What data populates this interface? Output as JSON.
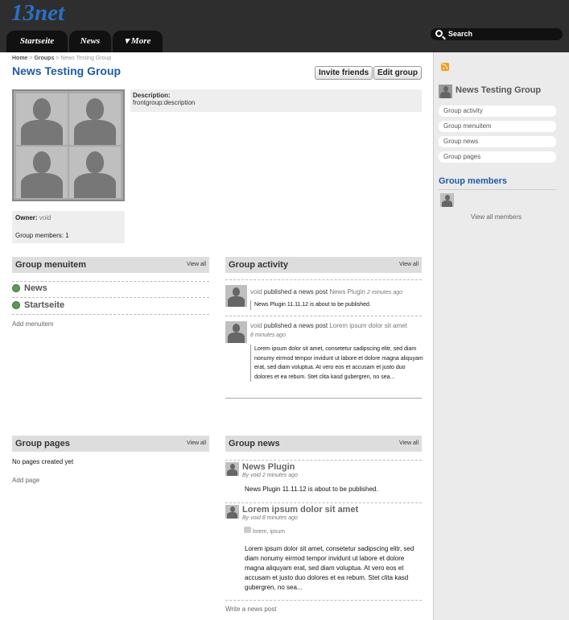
{
  "site": {
    "logo": "13net"
  },
  "nav": {
    "tabs": [
      "Startseite",
      "News",
      "▾ More"
    ],
    "search_label": "Search"
  },
  "breadcrumb": {
    "home": "Home",
    "sep1": ">",
    "groups": "Groups",
    "sep2": ">",
    "current": "News Testing Group"
  },
  "group": {
    "title": "News Testing Group",
    "invite_label": "Invite friends",
    "edit_label": "Edit group",
    "description_label": "Description:",
    "description_value": "frontgroup:description",
    "owner_label": "Owner:",
    "owner_value": "void",
    "members_text": "Group members: 1"
  },
  "menuitem_widget": {
    "title": "Group menuitem",
    "view_all": "View all",
    "items": [
      "News",
      "Startseite"
    ],
    "add_label": "Add menuitem"
  },
  "activity_widget": {
    "title": "Group activity",
    "view_all": "View all",
    "items": [
      {
        "user": "void",
        "action": "published a news post",
        "target": "News Plugin",
        "time": "2 minutes ago",
        "excerpt": "News Plugin 11.11.12 is about to be published."
      },
      {
        "user": "void",
        "action": "published a news post",
        "target": "Lorem ipsum dolor sit amet",
        "time": "8 minutes ago",
        "excerpt": "Lorem ipsum dolor sit amet, consetetur sadipscing elitr, sed diam nonumy eirmod tempor invidunt ut labore et dolore magna aliquyam erat, sed diam voluptua. At vero eos et accusam et justo duo dolores et ea rebum. Stet clita kasd gubergren, no sea..."
      }
    ]
  },
  "pages_widget": {
    "title": "Group pages",
    "view_all": "View all",
    "empty": "No pages created yet",
    "add_label": "Add page"
  },
  "news_widget": {
    "title": "Group news",
    "view_all": "View all",
    "posts": [
      {
        "title": "News Plugin",
        "byline": "By void 2 minutes ago",
        "body": "News Plugin 11.11.12 is about to be published."
      },
      {
        "title": "Lorem ipsum dolor sit amet",
        "byline": "By void 8 minutes ago",
        "tags": "lorem, ipsum",
        "body": "Lorem ipsum dolor sit amet, consetetur sadipscing elitr, sed diam nonumy eirmod tempor invidunt ut labore et dolore magna aliquyam erat, sed diam voluptua. At vero eos et accusam et justo duo dolores et ea rebum. Stet clita kasd gubergren, no sea..."
      }
    ],
    "write_label": "Write a news post"
  },
  "sidebar": {
    "group_name": "News Testing Group",
    "links": [
      "Group activity",
      "Group menuitem",
      "Group news",
      "Group pages"
    ],
    "members_title": "Group members",
    "view_all_members": "View all members"
  },
  "icons": {
    "rss": "rss-icon",
    "search": "search-icon",
    "globe": "globe-icon"
  }
}
